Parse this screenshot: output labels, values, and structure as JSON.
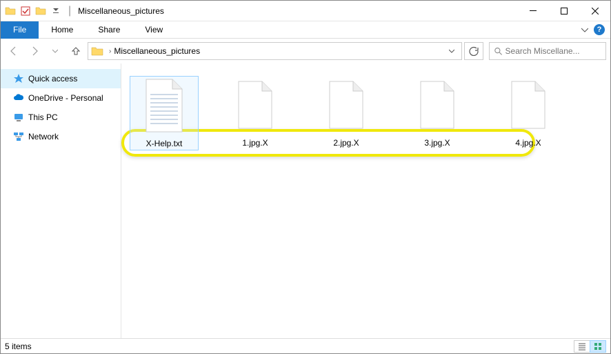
{
  "titlebar": {
    "separator": "|",
    "title": "Miscellaneous_pictures"
  },
  "ribbon": {
    "file": "File",
    "tabs": [
      "Home",
      "Share",
      "View"
    ]
  },
  "addr": {
    "path": "Miscellaneous_pictures"
  },
  "search": {
    "placeholder": "Search Miscellane..."
  },
  "nav": {
    "items": [
      {
        "label": "Quick access"
      },
      {
        "label": "OneDrive - Personal"
      },
      {
        "label": "This PC"
      },
      {
        "label": "Network"
      }
    ]
  },
  "files": [
    {
      "name": "X-Help.txt",
      "selected": true,
      "type": "txt"
    },
    {
      "name": "1.jpg.X",
      "selected": false,
      "type": "blank"
    },
    {
      "name": "2.jpg.X",
      "selected": false,
      "type": "blank"
    },
    {
      "name": "3.jpg.X",
      "selected": false,
      "type": "blank"
    },
    {
      "name": "4.jpg.X",
      "selected": false,
      "type": "blank"
    }
  ],
  "status": {
    "count": "5 items"
  }
}
